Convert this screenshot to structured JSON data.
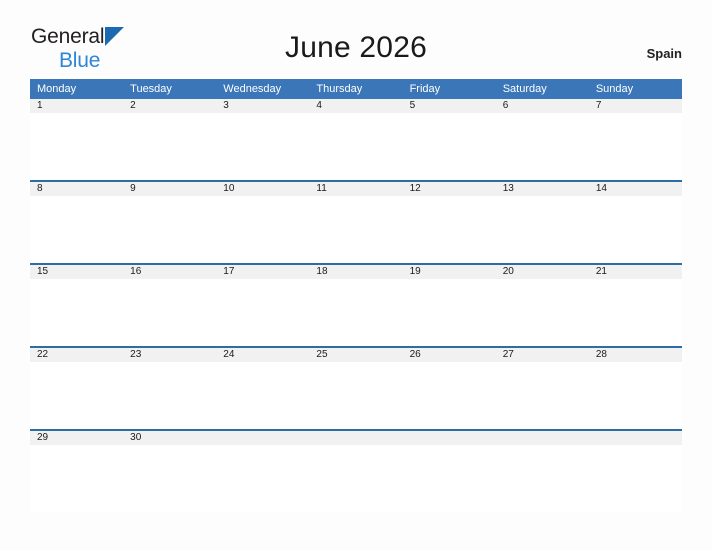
{
  "brand": {
    "line1": "General",
    "line2": "Blue",
    "triangle_icon": "triangle-right-icon",
    "triangle_color": "#1b69b0",
    "line2_color": "#2f86d4"
  },
  "header": {
    "title": "June 2026",
    "region": "Spain"
  },
  "theme": {
    "header_blue": "#3a76b8",
    "rule_blue": "#2e6da4",
    "band_gray": "#f1f1f1",
    "page_background": "#fdfdfd",
    "text_dark": "#1a1a1a"
  },
  "calendar": {
    "month": "June",
    "year": "2026",
    "weekday_headers": [
      "Monday",
      "Tuesday",
      "Wednesday",
      "Thursday",
      "Friday",
      "Saturday",
      "Sunday"
    ],
    "weeks": [
      {
        "days": [
          "1",
          "2",
          "3",
          "4",
          "5",
          "6",
          "7"
        ]
      },
      {
        "days": [
          "8",
          "9",
          "10",
          "11",
          "12",
          "13",
          "14"
        ]
      },
      {
        "days": [
          "15",
          "16",
          "17",
          "18",
          "19",
          "20",
          "21"
        ]
      },
      {
        "days": [
          "22",
          "23",
          "24",
          "25",
          "26",
          "27",
          "28"
        ]
      },
      {
        "days": [
          "29",
          "30",
          "",
          "",
          "",
          "",
          ""
        ]
      }
    ]
  }
}
